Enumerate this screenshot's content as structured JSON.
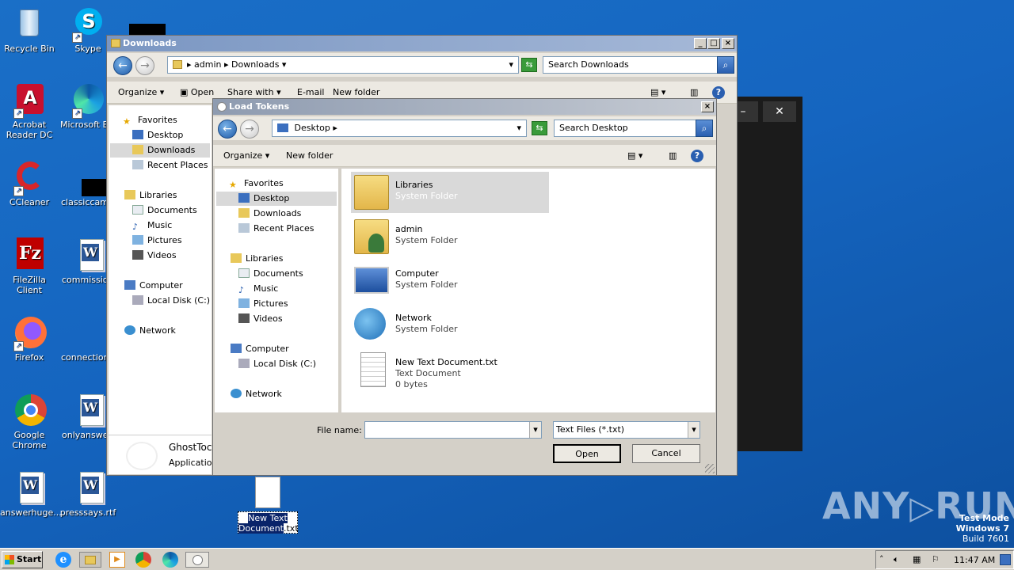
{
  "desktop": {
    "icons": [
      {
        "label": "Recycle Bin",
        "icon": "recycle-bin-icon"
      },
      {
        "label": "Skype",
        "icon": "skype-icon"
      },
      {
        "label": "Acrobat Reader DC",
        "icon": "acrobat-icon"
      },
      {
        "label": "Microsoft Ed",
        "icon": "edge-icon"
      },
      {
        "label": "CCleaner",
        "icon": "ccleaner-icon"
      },
      {
        "label": "classiccame",
        "icon": "black-icon"
      },
      {
        "label": "FileZilla Client",
        "icon": "filezilla-icon"
      },
      {
        "label": "commission",
        "icon": "word-doc-icon"
      },
      {
        "label": "Firefox",
        "icon": "firefox-icon"
      },
      {
        "label": "connectionc",
        "icon": "none"
      },
      {
        "label": "Google Chrome",
        "icon": "chrome-icon"
      },
      {
        "label": "onlyanswer",
        "icon": "word-doc-icon"
      },
      {
        "label": "answerhuge....",
        "icon": "word-doc-icon"
      },
      {
        "label": "presssays.rtf",
        "icon": "word-doc-icon"
      }
    ],
    "selected_file_label_line1": "New Text",
    "selected_file_label_line2_sel": "Document",
    "selected_file_label_line2_rest": ".txt"
  },
  "explorer": {
    "title": "Downloads",
    "address": [
      "admin",
      "Downloads"
    ],
    "search_placeholder": "Search Downloads",
    "toolbar": {
      "organize": "Organize",
      "open": "Open",
      "share": "Share with",
      "email": "E-mail",
      "new_folder": "New folder"
    },
    "nav": {
      "favorites": "Favorites",
      "desktop": "Desktop",
      "downloads": "Downloads",
      "recent": "Recent Places",
      "libraries": "Libraries",
      "documents": "Documents",
      "music": "Music",
      "pictures": "Pictures",
      "videos": "Videos",
      "computer": "Computer",
      "local_disk": "Local Disk (C:)",
      "network": "Network"
    },
    "partial_item_name": "GhostToc",
    "partial_item_type": "Application"
  },
  "dialog": {
    "title": "Load Tokens",
    "address": "Desktop",
    "search_placeholder": "Search Desktop",
    "toolbar": {
      "organize": "Organize",
      "new_folder": "New folder"
    },
    "nav": {
      "favorites": "Favorites",
      "desktop": "Desktop",
      "downloads": "Downloads",
      "recent": "Recent Places",
      "libraries": "Libraries",
      "documents": "Documents",
      "music": "Music",
      "pictures": "Pictures",
      "videos": "Videos",
      "computer": "Computer",
      "local_disk": "Local Disk (C:)",
      "network": "Network"
    },
    "items": [
      {
        "name": "Libraries",
        "type": "System Folder",
        "extra": ""
      },
      {
        "name": "admin",
        "type": "System Folder",
        "extra": ""
      },
      {
        "name": "Computer",
        "type": "System Folder",
        "extra": ""
      },
      {
        "name": "Network",
        "type": "System Folder",
        "extra": ""
      },
      {
        "name": "New Text Document.txt",
        "type": "Text Document",
        "extra": "0 bytes"
      }
    ],
    "file_name_label": "File name:",
    "file_name_value": "",
    "file_type": "Text Files (*.txt)",
    "open": "Open",
    "cancel": "Cancel"
  },
  "dark_window": {
    "minimize": "–",
    "close": "✕"
  },
  "watermark": {
    "brand": "ANY",
    "brand2": "RUN",
    "line1": "Test Mode",
    "line2": "Windows 7",
    "line3": "Build 7601"
  },
  "taskbar": {
    "start": "Start",
    "time": "11:47 AM"
  }
}
